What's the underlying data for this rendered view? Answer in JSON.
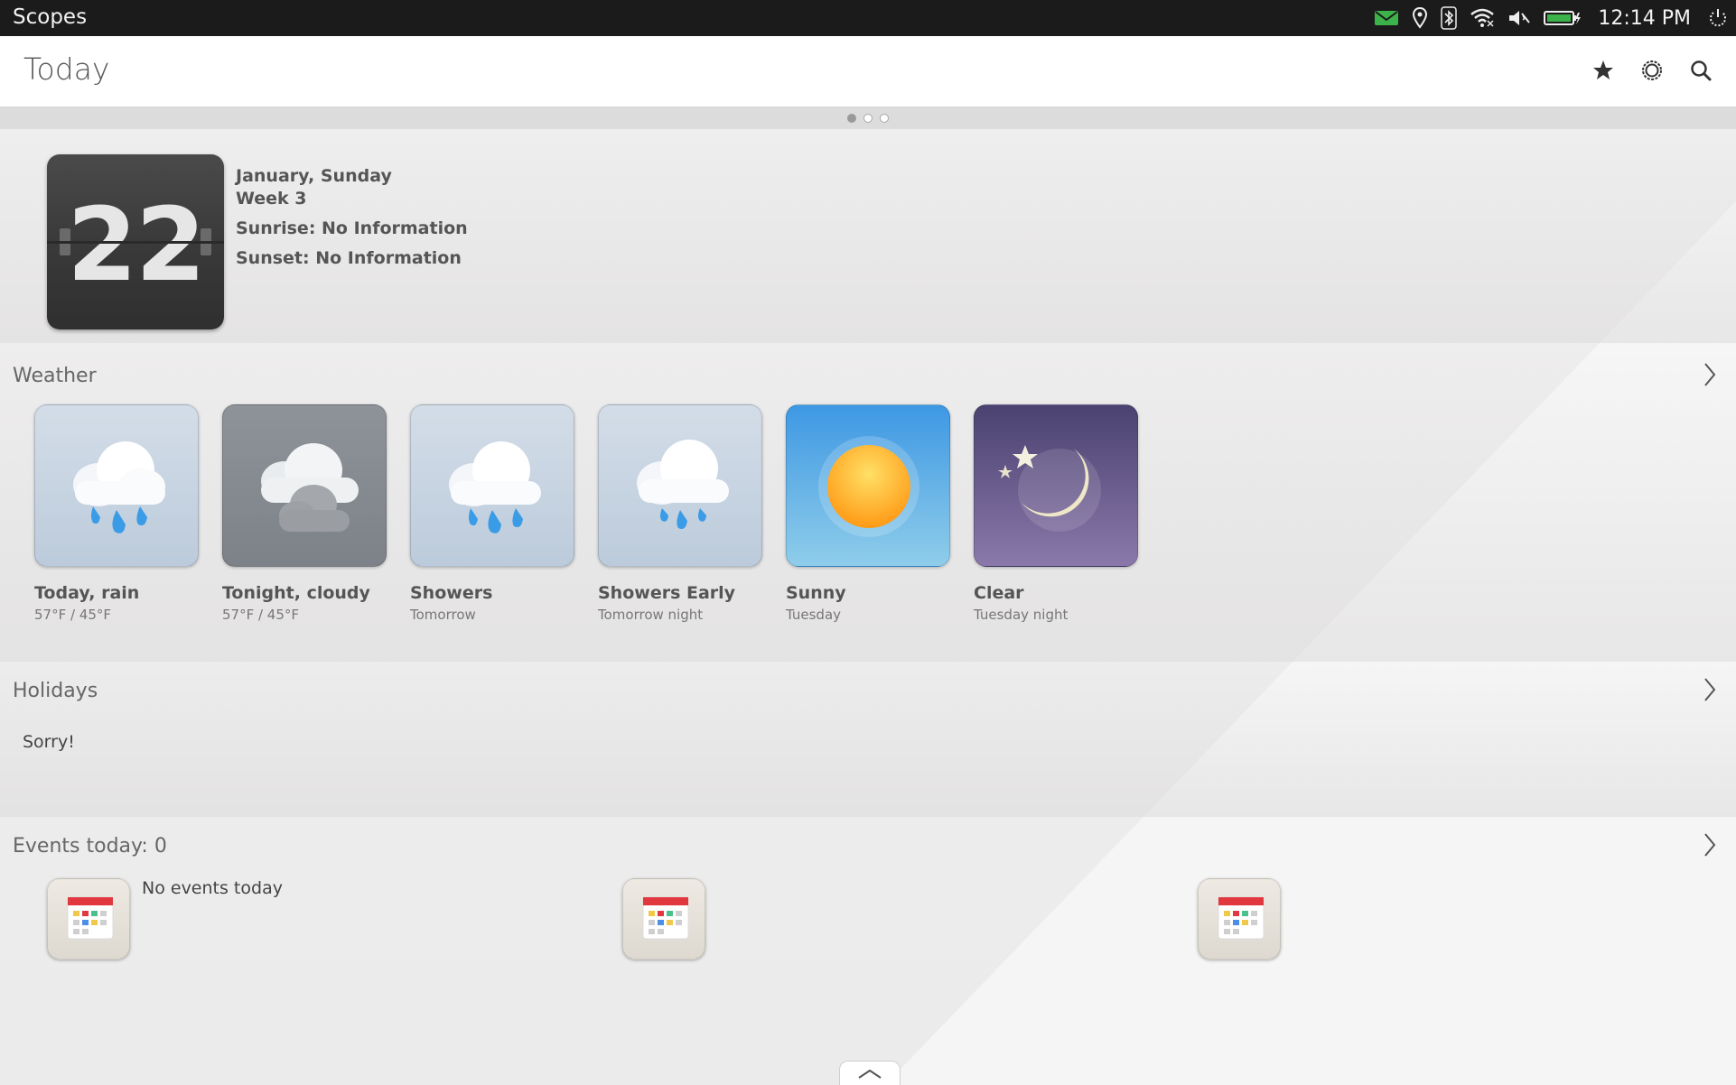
{
  "status_bar": {
    "app_label": "Scopes",
    "time": "12:14 PM",
    "icons": [
      "message-icon",
      "location-icon",
      "bluetooth-icon",
      "wifi-icon",
      "volume-muted-icon",
      "battery-icon",
      "power-icon"
    ]
  },
  "header": {
    "title": "Today",
    "actions": [
      "favorite-star-icon",
      "settings-icon",
      "search-icon"
    ]
  },
  "pager": {
    "count": 3,
    "active": 0
  },
  "date": {
    "day": "22",
    "month_day": "January, Sunday",
    "week": "Week 3",
    "sunrise": "Sunrise: No Information",
    "sunset": "Sunset: No Information"
  },
  "weather": {
    "title": "Weather",
    "cards": [
      {
        "name": "Today, rain",
        "sub": "57°F / 45°F",
        "icon": "rain-cloud-icon"
      },
      {
        "name": "Tonight, cloudy",
        "sub": "57°F / 45°F",
        "icon": "cloudy-icon"
      },
      {
        "name": "Showers",
        "sub": "Tomorrow",
        "icon": "showers-icon"
      },
      {
        "name": "Showers Early",
        "sub": "Tomorrow night",
        "icon": "showers-icon"
      },
      {
        "name": "Sunny",
        "sub": "Tuesday",
        "icon": "sun-icon"
      },
      {
        "name": "Clear",
        "sub": "Tuesday night",
        "icon": "moon-stars-icon"
      }
    ]
  },
  "holidays": {
    "title": "Holidays",
    "message": "Sorry!"
  },
  "events": {
    "title": "Events today: 0",
    "items": [
      {
        "text": "No events today",
        "icon": "calendar-icon"
      },
      {
        "text": "",
        "icon": "calendar-icon"
      },
      {
        "text": "",
        "icon": "calendar-icon"
      }
    ]
  },
  "colors": {
    "status_bar_bg": "#1b1b1b",
    "header_bg": "#ffffff",
    "background": "#ecebeb",
    "accent_blue": "#3a9be6",
    "sunny_bg": "#5aa9e6",
    "clear_night_bg": "#5b4f86"
  }
}
